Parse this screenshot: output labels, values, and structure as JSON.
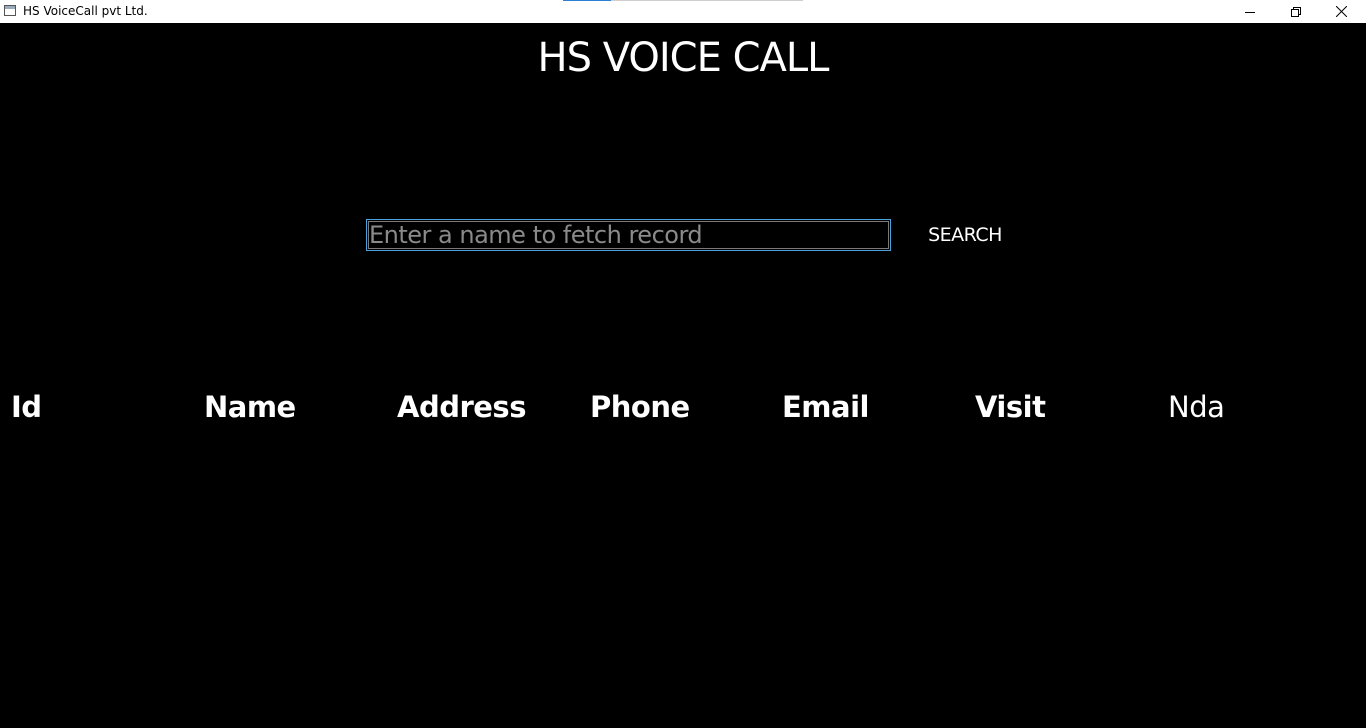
{
  "window": {
    "title": "HS VoiceCall pvt Ltd.",
    "controls": [
      "minimize-icon",
      "restore-icon",
      "close-icon"
    ]
  },
  "header": {
    "title": "HS VOICE CALL"
  },
  "search": {
    "placeholder": "Enter a name to fetch record",
    "value": "",
    "button_label": "SEARCH"
  },
  "table": {
    "columns": [
      "Id",
      "Name",
      "Address",
      "Phone",
      "Email",
      "Visit",
      "Nda"
    ]
  },
  "colors": {
    "background": "#000000",
    "text": "#ffffff",
    "input_border": "#4aa3df",
    "placeholder": "#8a8a8a"
  }
}
